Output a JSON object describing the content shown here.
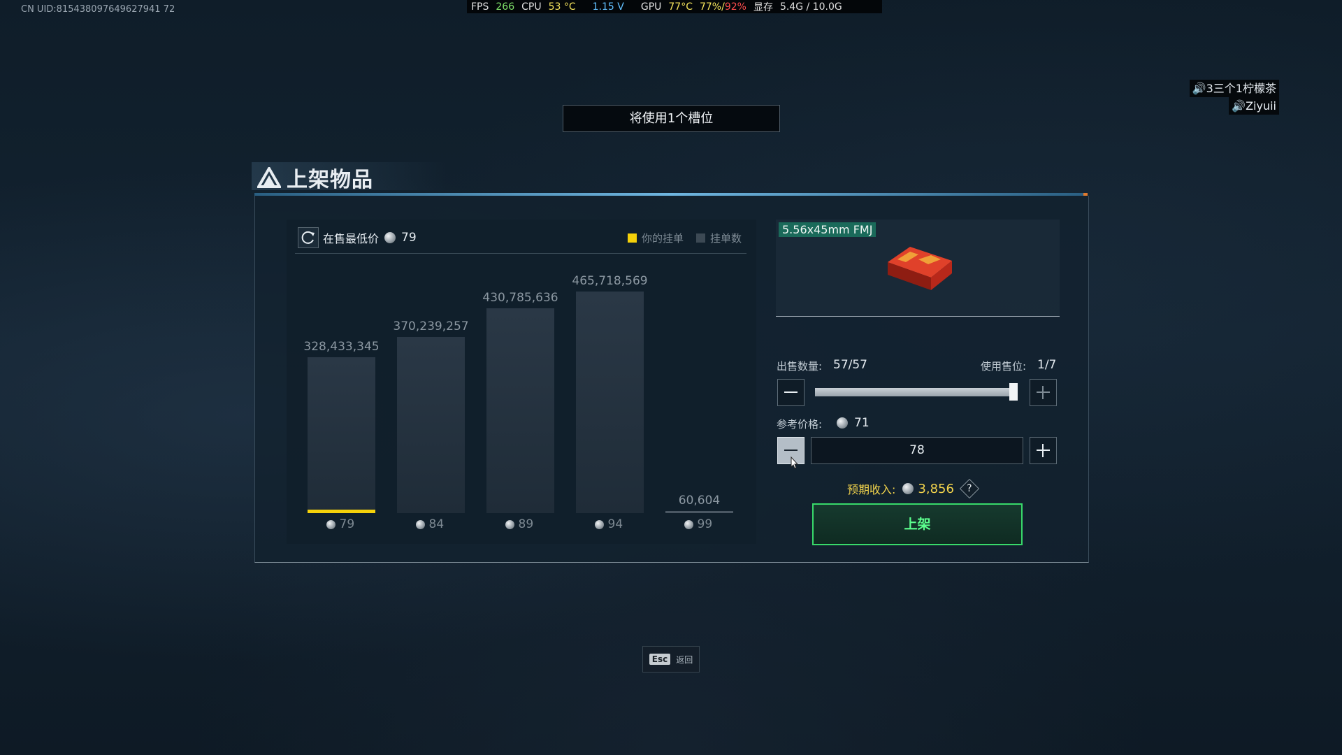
{
  "uid": "CN UID:815438097649627941 72",
  "hud": {
    "fps_label": "FPS",
    "fps": "266",
    "cpu_label": "CPU",
    "cpu_temp": "53 °C",
    "cpu_volt": "1.15 V",
    "gpu_label": "GPU",
    "gpu_temp": "77°C",
    "gpu_load": "77%/",
    "gpu_load2": "92%",
    "vram_label": "显存",
    "vram": "5.4G / 10.0G"
  },
  "players": [
    "🔊3三个1柠檬茶",
    "🔊Ziyuii"
  ],
  "slot_notice": "将使用1个槽位",
  "title": "上架物品",
  "chart_header": {
    "lowest_label": "在售最低价",
    "lowest_value": "79"
  },
  "legend": {
    "yours": "你的挂单",
    "count": "挂单数"
  },
  "colors": {
    "yours": "#f5d10a",
    "count": "#3c4954",
    "confirm": "#38d96a"
  },
  "chart_data": {
    "type": "bar",
    "categories": [
      "79",
      "84",
      "89",
      "94",
      "99"
    ],
    "series": [
      {
        "name": "挂单数",
        "values": [
          328433345,
          370239257,
          430785636,
          465718569,
          60604
        ]
      }
    ],
    "labels": [
      "328,433,345",
      "370,239,257",
      "430,785,636",
      "465,718,569",
      "60,604"
    ],
    "your_listing_category": "79",
    "ylim": [
      0,
      500000000
    ]
  },
  "item": {
    "name": "5.56x45mm FMJ"
  },
  "quantity": {
    "label": "出售数量:",
    "value": "57/57",
    "fraction": 1.0
  },
  "slots": {
    "label": "使用售位:",
    "value": "1/7"
  },
  "reference": {
    "label": "参考价格:",
    "value": "71"
  },
  "price": {
    "value": "78"
  },
  "income": {
    "label": "预期收入:",
    "value": "3,856",
    "help": "?"
  },
  "confirm_label": "上架",
  "esc": {
    "key": "Esc",
    "label": "返回"
  }
}
